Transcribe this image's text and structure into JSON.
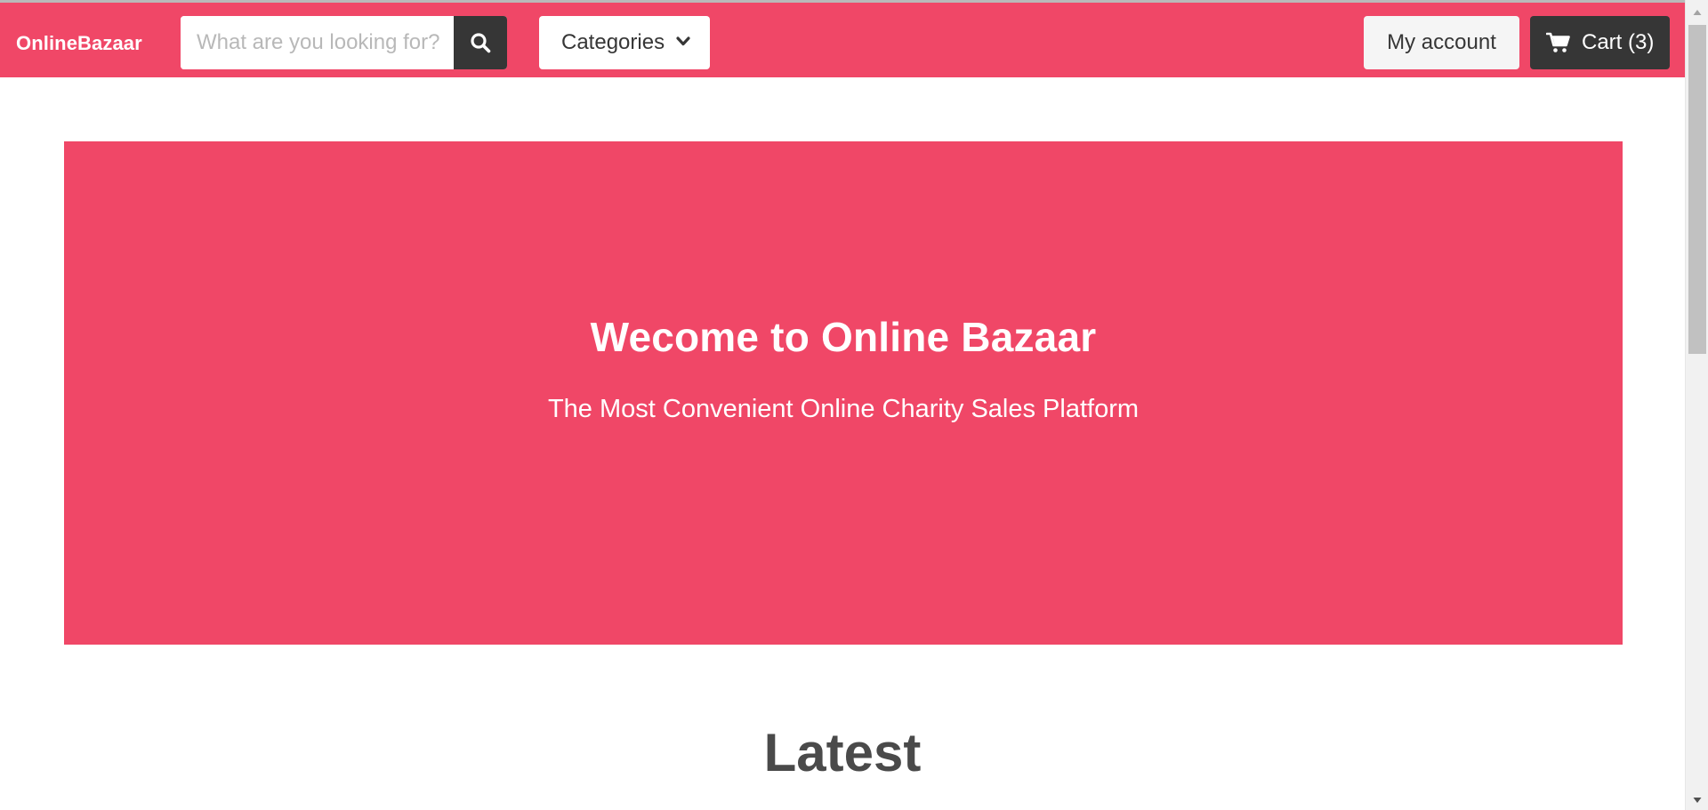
{
  "colors": {
    "brand": "#f04767",
    "dark": "#363636",
    "light_button": "#f5f5f5"
  },
  "navbar": {
    "brand": "OnlineBazaar",
    "search": {
      "placeholder": "What are you looking for?",
      "value": "",
      "icon": "search-icon"
    },
    "categories_label": "Categories",
    "account_label": "My account",
    "cart_label": "Cart (3)",
    "cart_icon": "shopping-cart-icon"
  },
  "hero": {
    "title": "Wecome to Online Bazaar",
    "subtitle": "The Most Convenient Online Charity Sales Platform"
  },
  "sections": {
    "latest_title": "Latest"
  }
}
